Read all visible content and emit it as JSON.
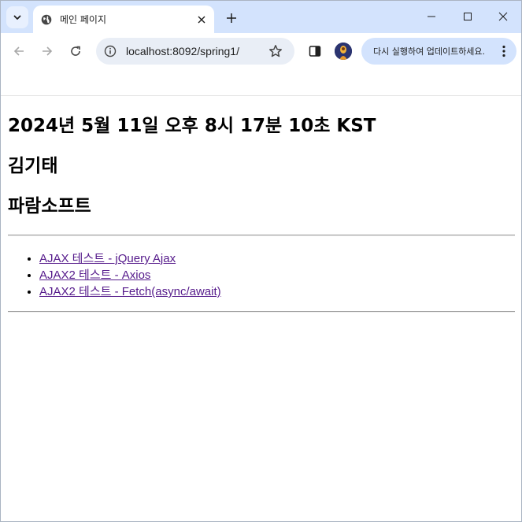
{
  "browser": {
    "tab_title": "메인 페이지",
    "url": "localhost:8092/spring1/",
    "update_label": "다시 실행하여 업데이트하세요.",
    "icons": {
      "tab_search": "chevron-down-icon",
      "favicon": "globe-icon",
      "close": "close-icon",
      "new_tab": "plus-icon",
      "minimize": "minimize-icon",
      "maximize": "maximize-icon",
      "window_close": "close-icon",
      "back": "back-arrow-icon",
      "forward": "forward-arrow-icon",
      "reload": "reload-icon",
      "site_info": "info-icon",
      "bookmark": "star-icon",
      "side_panel": "side-panel-icon",
      "menu": "kebab-menu-icon"
    },
    "colors": {
      "tabstrip": "#d3e3fd",
      "omnibox": "#e9eef6",
      "visited_link": "#551a8b"
    }
  },
  "page": {
    "datetime": "2024년 5월 11일 오후 8시 17분 10초 KST",
    "name": "김기태",
    "company": "파람소프트",
    "links": [
      {
        "label": "AJAX 테스트 - jQuery Ajax"
      },
      {
        "label": "AJAX2 테스트 - Axios"
      },
      {
        "label": "AJAX2 테스트 - Fetch(async/await)"
      }
    ]
  }
}
